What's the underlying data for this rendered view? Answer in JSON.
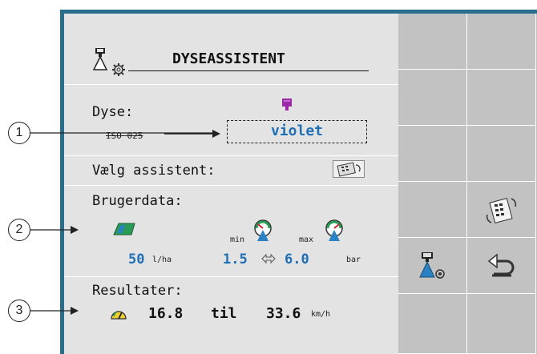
{
  "header": {
    "title": "DYSEASSISTENT"
  },
  "nozzle": {
    "label": "Dyse:",
    "standard": "ISO 025",
    "color_value": "violet",
    "color_hex": "#9a2aa8"
  },
  "assistant": {
    "label": "Vælg assistent:"
  },
  "user_data": {
    "label": "Brugerdata:",
    "rate_value": "50",
    "rate_unit": "l/ha",
    "min_label": "min",
    "max_label": "max",
    "min_pressure": "1.5",
    "max_pressure": "6.0",
    "pressure_unit": "bar"
  },
  "results": {
    "label": "Resultater:",
    "speed_min": "16.8",
    "to_word": "til",
    "speed_max": "33.6",
    "speed_unit": "km/h"
  },
  "callouts": [
    "1",
    "2",
    "3"
  ],
  "softkeys": {
    "icons": [
      "nozzle-assistant-icon",
      "back-arrow-icon",
      "calculator-refresh-icon"
    ]
  },
  "colors": {
    "frame": "#2a6e8e",
    "panel": "#e3e3e3",
    "softkey_bg": "#c2c2c2",
    "value_blue": "#1f6fb5",
    "violet": "#9a2aa8"
  }
}
